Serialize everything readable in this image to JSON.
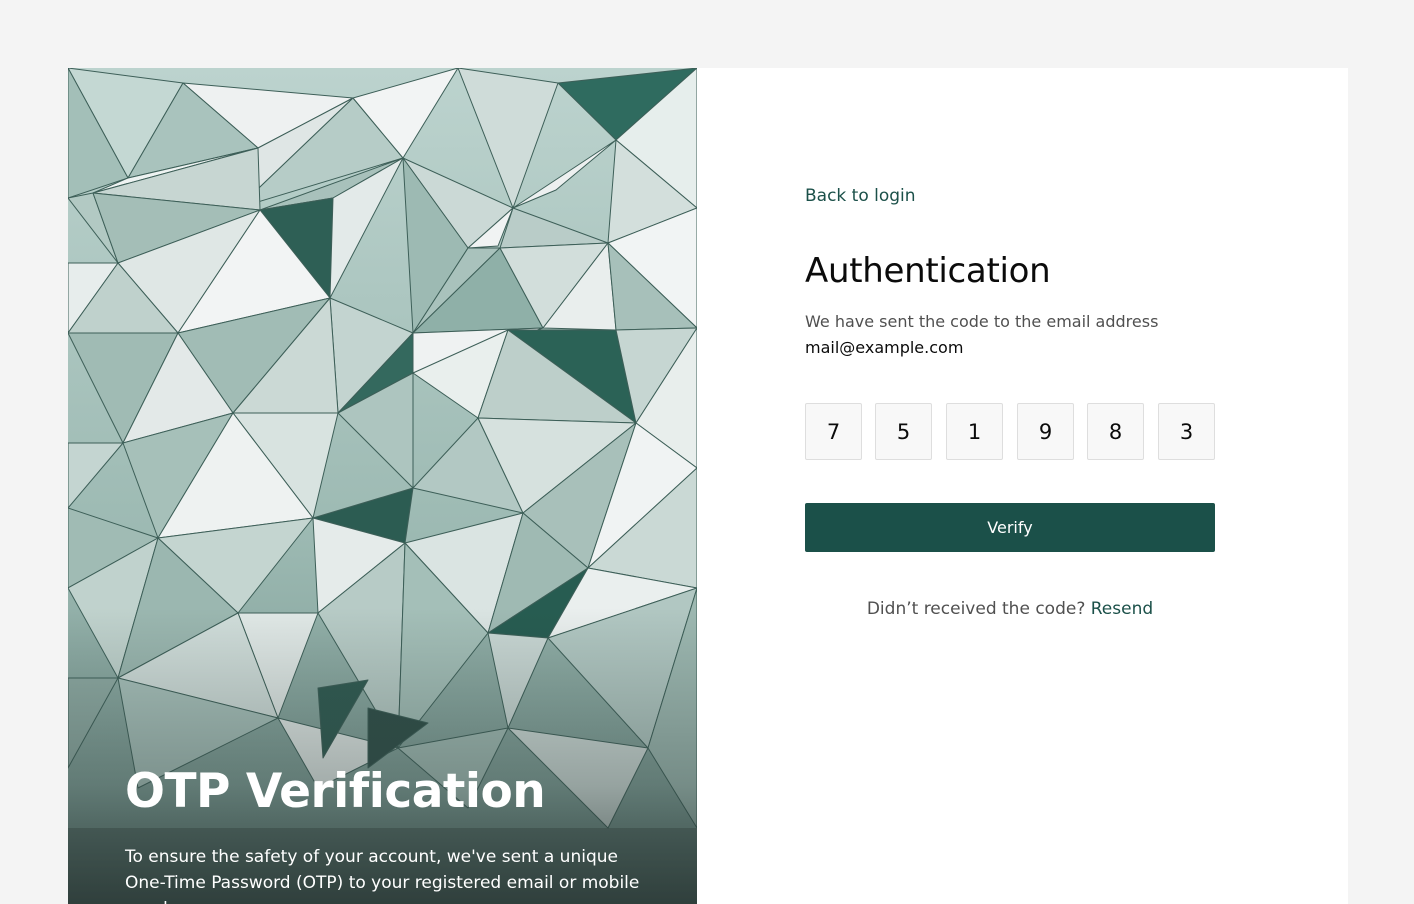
{
  "hero": {
    "title": "OTP Verification",
    "description": "To ensure the safety of your account, we've sent a unique One-Time Password (OTP) to your registered email or mobile number."
  },
  "form": {
    "back_label": "Back to login",
    "title": "Authentication",
    "subtitle": "We have sent the code to the email address",
    "email": "mail@example.com",
    "otp_digits": [
      "7",
      "5",
      "1",
      "9",
      "8",
      "3"
    ],
    "verify_label": "Verify",
    "resend_question": "Didn’t received the code?",
    "resend_label": "Resend"
  },
  "colors": {
    "brand": "#1b5049",
    "page_background": "#f4f4f4",
    "card_background": "#ffffff",
    "otp_box_fill": "#f8f8f8",
    "otp_box_border": "#dedede"
  }
}
